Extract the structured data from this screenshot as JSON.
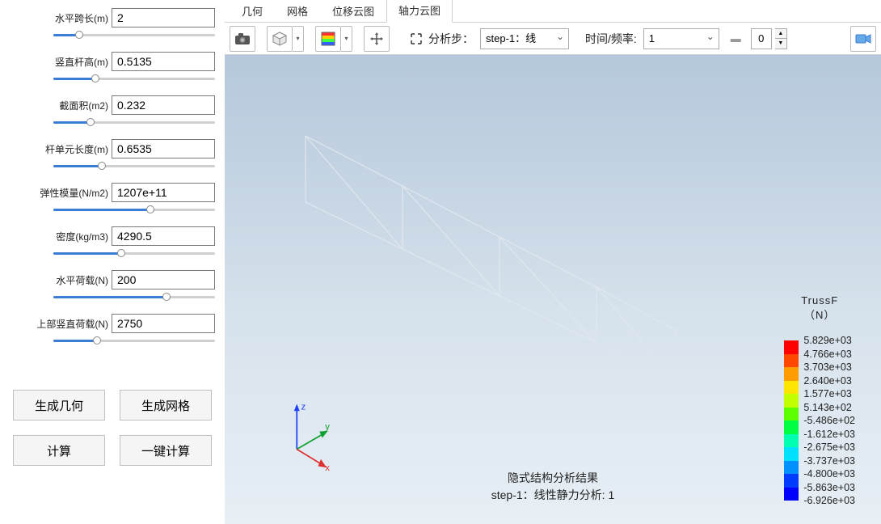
{
  "params": [
    {
      "label": "水平跨长(m)",
      "value": "2",
      "pos": 16
    },
    {
      "label": "竖直杆高(m)",
      "value": "0.5135",
      "pos": 26
    },
    {
      "label": "截面积(m2)",
      "value": "0.232",
      "pos": 23
    },
    {
      "label": "杆单元长度(m)",
      "value": "0.6535",
      "pos": 30
    },
    {
      "label": "弹性模量(N/m2)",
      "value": "1207e+11",
      "pos": 60
    },
    {
      "label": "密度(kg/m3)",
      "value": "4290.5",
      "pos": 42
    },
    {
      "label": "水平荷载(N)",
      "value": "200",
      "pos": 70
    },
    {
      "label": "上部竖直荷载(N)",
      "value": "2750",
      "pos": 27
    }
  ],
  "buttons": {
    "gen_geom": "生成几何",
    "gen_mesh": "生成网格",
    "compute": "计算",
    "onekey": "一键计算"
  },
  "tabs": [
    {
      "label": "几何",
      "active": false
    },
    {
      "label": "网格",
      "active": false
    },
    {
      "label": "位移云图",
      "active": false
    },
    {
      "label": "轴力云图",
      "active": true
    }
  ],
  "toolbar": {
    "step_label": "分析步：",
    "step_value": "step-1：线",
    "time_label": "时间/频率:",
    "time_value": "1",
    "frame_value": "0"
  },
  "viewport": {
    "caption_line1": "隐式结构分析结果",
    "caption_line2": "step-1：线性静力分析: 1",
    "axis_x": "x",
    "axis_y": "y",
    "axis_z": "z"
  },
  "legend": {
    "title_l1": "TrussF",
    "title_l2": "（N）",
    "entries": [
      {
        "color": "#ff0000",
        "value": "5.829e+03"
      },
      {
        "color": "#ff4700",
        "value": "4.766e+03"
      },
      {
        "color": "#ff9d00",
        "value": "3.703e+03"
      },
      {
        "color": "#ffe600",
        "value": "2.640e+03"
      },
      {
        "color": "#c2ff00",
        "value": "1.577e+03"
      },
      {
        "color": "#5dff00",
        "value": "5.143e+02"
      },
      {
        "color": "#00ff43",
        "value": "-5.486e+02"
      },
      {
        "color": "#00ffb0",
        "value": "-1.612e+03"
      },
      {
        "color": "#00e0ff",
        "value": "-2.675e+03"
      },
      {
        "color": "#0091ff",
        "value": "-3.737e+03"
      },
      {
        "color": "#003cff",
        "value": "-4.800e+03"
      },
      {
        "color": "#0000ff",
        "value": "-5.863e+03"
      }
    ],
    "last_value": "-6.926e+03"
  }
}
